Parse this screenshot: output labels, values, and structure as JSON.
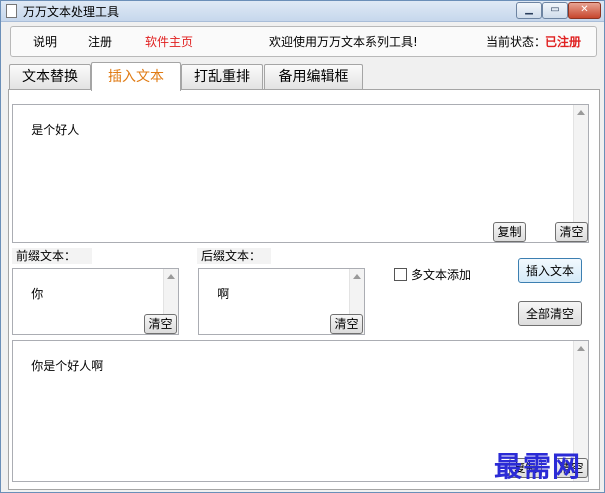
{
  "window": {
    "title": "万万文本处理工具",
    "min_label": "▁",
    "max_label": "▭",
    "close_label": "✕"
  },
  "topbar": {
    "readme": "说明",
    "register": "注册",
    "homepage": "软件主页",
    "welcome": "欢迎使用万万文本系列工具!",
    "status_label": "当前状态：",
    "status_value": "已注册"
  },
  "tabs": [
    {
      "label": "文本替换",
      "active": false
    },
    {
      "label": "插入文本",
      "active": true
    },
    {
      "label": "打乱重排",
      "active": false
    },
    {
      "label": "备用编辑框",
      "active": false
    }
  ],
  "source": {
    "value": "是个好人",
    "copy_label": "复制",
    "clear_label": "清空"
  },
  "prefix": {
    "label": "前缀文本：",
    "value": "你",
    "clear_label": "清空"
  },
  "suffix": {
    "label": "后缀文本：",
    "value": "啊",
    "clear_label": "清空"
  },
  "options": {
    "multi_text_label": "多文本添加",
    "multi_text_checked": false
  },
  "actions": {
    "insert_label": "插入文本",
    "clear_all_label": "全部清空"
  },
  "result": {
    "value": "你是个好人啊",
    "copy_label": "复制",
    "clear_label": "清空"
  },
  "watermark": "最需网"
}
